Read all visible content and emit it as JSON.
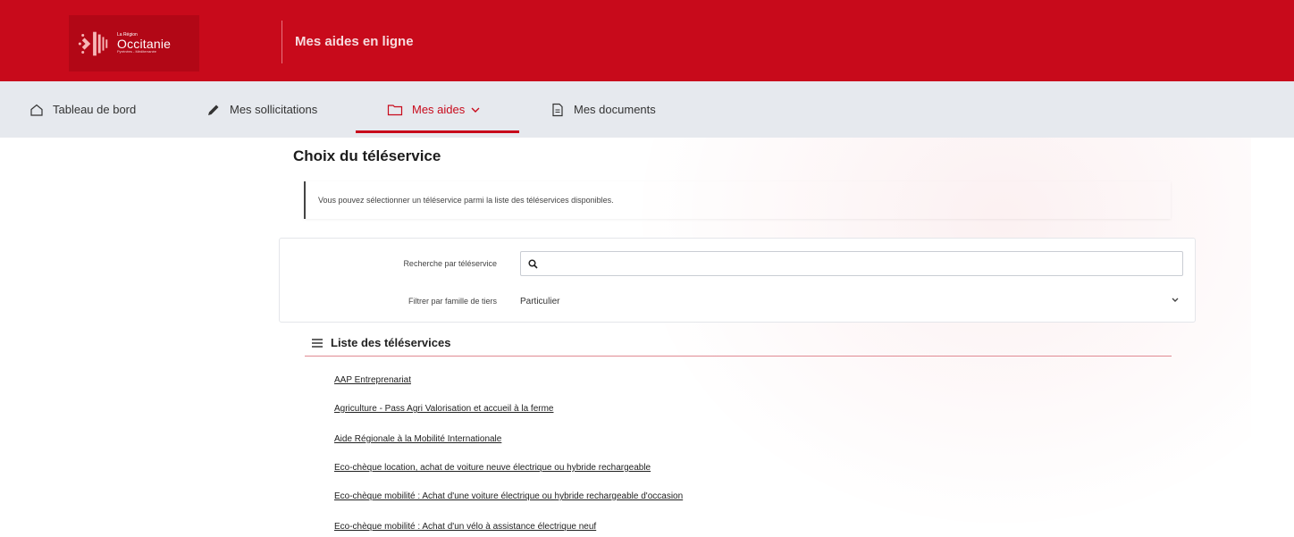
{
  "brand": {
    "logo_small": "La Région",
    "logo_name": "Occitanie",
    "logo_tagline": "Pyrénées - Méditerranée",
    "app_title": "Mes aides en ligne",
    "color_primary": "#c80a1b"
  },
  "nav": {
    "items": [
      {
        "label": "Tableau de bord",
        "icon": "home-icon"
      },
      {
        "label": "Mes sollicitations",
        "icon": "pencil-icon"
      },
      {
        "label": "Mes aides",
        "icon": "folder-icon",
        "active": true
      },
      {
        "label": "Mes documents",
        "icon": "document-icon"
      }
    ]
  },
  "main": {
    "title": "Choix du téléservice",
    "info": "Vous pouvez sélectionner un téléservice parmi la liste des téléservices disponibles.",
    "filters": {
      "search_label": "Recherche par téléservice",
      "search_value": "",
      "family_label": "Filtrer par famille de tiers",
      "family_value": "Particulier"
    },
    "list_title": "Liste des téléservices",
    "services": [
      "AAP Entreprenariat",
      "Agriculture - Pass Agri Valorisation et accueil à la ferme",
      "Aide Régionale à la Mobilité Internationale",
      "Eco-chèque location, achat de voiture neuve électrique ou hybride rechargeable",
      "Eco-chèque mobilité : Achat d'une voiture électrique ou hybride rechargeable d'occasion",
      "Eco-chèque mobilité : Achat d'un vélo à assistance électrique neuf"
    ]
  }
}
